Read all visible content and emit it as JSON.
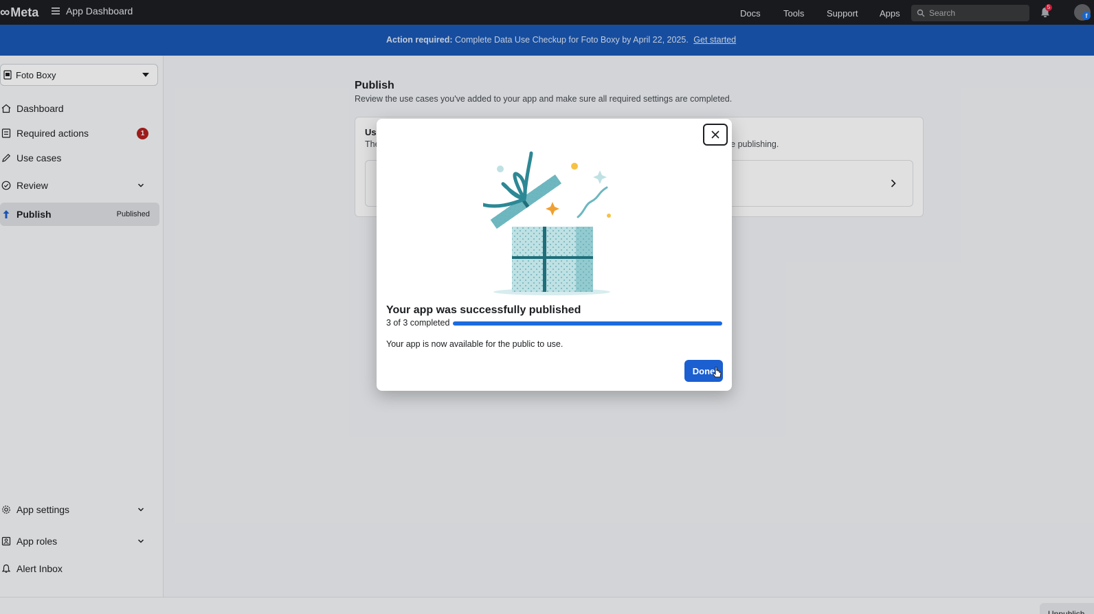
{
  "header": {
    "brand": "Meta",
    "app_dashboard": "App Dashboard",
    "nav": {
      "docs": "Docs",
      "tools": "Tools",
      "support": "Support",
      "apps": "Apps"
    },
    "search_placeholder": "Search",
    "notification_count": "5"
  },
  "banner": {
    "prefix": "Action required:",
    "message": "Complete Data Use Checkup for Foto Boxy by April 22, 2025.",
    "link": "Get started"
  },
  "sidebar": {
    "app_name": "Foto Boxy",
    "items": [
      {
        "label": "Dashboard"
      },
      {
        "label": "Required actions",
        "count": "1"
      },
      {
        "label": "Use cases"
      },
      {
        "label": "Review"
      },
      {
        "label": "Publish",
        "status": "Published"
      }
    ],
    "bottom_items": [
      {
        "label": "App settings"
      },
      {
        "label": "App roles"
      },
      {
        "label": "Alert Inbox"
      }
    ]
  },
  "main": {
    "title": "Publish",
    "subtitle": "Review the use cases you've added to your app and make sure all required settings are completed.",
    "card_title_partial": "Use",
    "card_sub_partial_left": "The",
    "card_sub_partial_right": "re publishing."
  },
  "modal": {
    "title": "Your app was successfully published",
    "progress_label": "3 of 3 completed",
    "progress_completed": 3,
    "progress_total": 3,
    "body": "Your app is now available for the public to use.",
    "done_label": "Done"
  },
  "bottom": {
    "unpublish": "Unpublish"
  },
  "colors": {
    "accent": "#1b5fd1",
    "banner": "#1a58b6",
    "topbar": "#1c1e21",
    "badge": "#b3201f"
  }
}
